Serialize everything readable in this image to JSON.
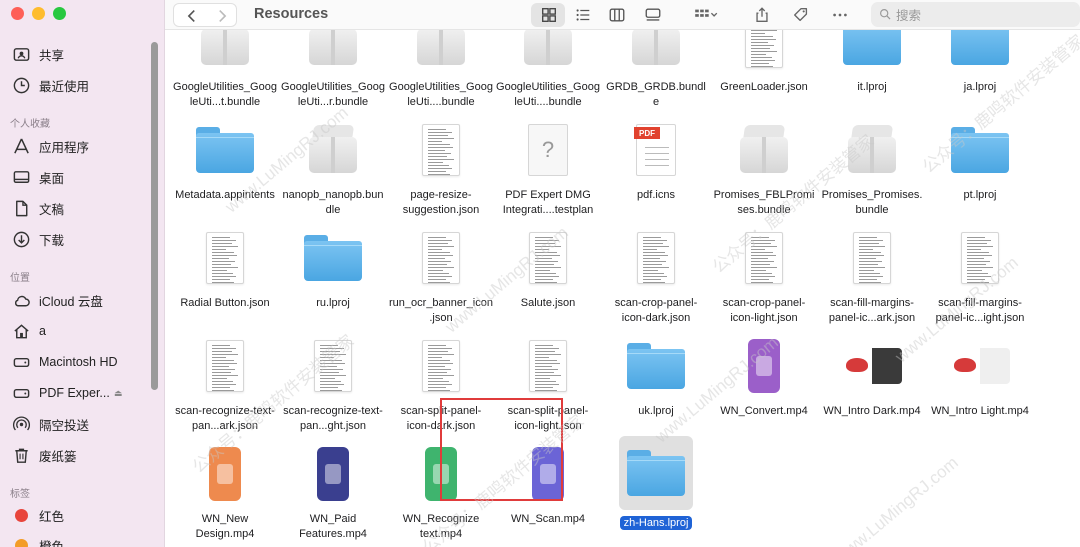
{
  "window": {
    "title": "Resources",
    "search_placeholder": "搜索"
  },
  "sidebar": {
    "top_items": [
      {
        "label": "共享",
        "icon": "shared-icon"
      },
      {
        "label": "最近使用",
        "icon": "clock-icon"
      }
    ],
    "favorites_heading": "个人收藏",
    "favorites": [
      {
        "label": "应用程序",
        "icon": "apps-icon"
      },
      {
        "label": "桌面",
        "icon": "desktop-icon"
      },
      {
        "label": "文稿",
        "icon": "document-icon"
      },
      {
        "label": "下载",
        "icon": "download-icon"
      }
    ],
    "locations_heading": "位置",
    "locations": [
      {
        "label": "iCloud 云盘",
        "icon": "cloud-icon"
      },
      {
        "label": "a",
        "icon": "home-icon"
      },
      {
        "label": "Macintosh HD",
        "icon": "disk-icon"
      },
      {
        "label": "PDF Exper...",
        "icon": "disk-icon",
        "eject": "⏏"
      },
      {
        "label": "隔空投送",
        "icon": "airdrop-icon"
      },
      {
        "label": "废纸篓",
        "icon": "trash-icon"
      }
    ],
    "tags_heading": "标签",
    "tags": [
      {
        "label": "红色",
        "color": "#e8453c"
      },
      {
        "label": "橙色",
        "color": "#f39c27"
      }
    ]
  },
  "files": [
    {
      "name": "GoogleUtilities_GoogleUti...t.bundle",
      "kind": "bundle"
    },
    {
      "name": "GoogleUtilities_GoogleUti...r.bundle",
      "kind": "bundle"
    },
    {
      "name": "GoogleUtilities_GoogleUti....bundle",
      "kind": "bundle"
    },
    {
      "name": "GoogleUtilities_GoogleUti....bundle",
      "kind": "bundle"
    },
    {
      "name": "GRDB_GRDB.bundle",
      "kind": "bundle"
    },
    {
      "name": "GreenLoader.json",
      "kind": "json"
    },
    {
      "name": "it.lproj",
      "kind": "folder"
    },
    {
      "name": "ja.lproj",
      "kind": "folder"
    },
    {
      "name": "Metadata.appintents",
      "kind": "folder"
    },
    {
      "name": "nanopb_nanopb.bundle",
      "kind": "bundle"
    },
    {
      "name": "page-resize-suggestion.json",
      "kind": "json"
    },
    {
      "name": "PDF Expert DMG Integrati....testplan",
      "kind": "unknown"
    },
    {
      "name": "pdf.icns",
      "kind": "pdf"
    },
    {
      "name": "Promises_FBLPromises.bundle",
      "kind": "bundle"
    },
    {
      "name": "Promises_Promises.bundle",
      "kind": "bundle"
    },
    {
      "name": "pt.lproj",
      "kind": "folder"
    },
    {
      "name": "Radial Button.json",
      "kind": "json"
    },
    {
      "name": "ru.lproj",
      "kind": "folder"
    },
    {
      "name": "run_ocr_banner_icon.json",
      "kind": "json"
    },
    {
      "name": "Salute.json",
      "kind": "json"
    },
    {
      "name": "scan-crop-panel-icon-dark.json",
      "kind": "json"
    },
    {
      "name": "scan-crop-panel-icon-light.json",
      "kind": "json"
    },
    {
      "name": "scan-fill-margins-panel-ic...ark.json",
      "kind": "json"
    },
    {
      "name": "scan-fill-margins-panel-ic...ight.json",
      "kind": "json"
    },
    {
      "name": "scan-recognize-text-pan...ark.json",
      "kind": "json"
    },
    {
      "name": "scan-recognize-text-pan...ght.json",
      "kind": "json"
    },
    {
      "name": "scan-split-panel-icon-dark.json",
      "kind": "json"
    },
    {
      "name": "scan-split-panel-icon-light.json",
      "kind": "json"
    },
    {
      "name": "uk.lproj",
      "kind": "folder"
    },
    {
      "name": "WN_Convert.mp4",
      "kind": "mp4",
      "color": "#9b5fc9"
    },
    {
      "name": "WN_Intro Dark.mp4",
      "kind": "intro-dark"
    },
    {
      "name": "WN_Intro Light.mp4",
      "kind": "intro-light"
    },
    {
      "name": "WN_New Design.mp4",
      "kind": "mp4",
      "color": "#ee8a4e"
    },
    {
      "name": "WN_Paid Features.mp4",
      "kind": "mp4",
      "color": "#3a3f8f"
    },
    {
      "name": "WN_Recognize text.mp4",
      "kind": "mp4",
      "color": "#3fb46e"
    },
    {
      "name": "WN_Scan.mp4",
      "kind": "mp4",
      "color": "#6b64d6"
    },
    {
      "name": "zh-Hans.lproj",
      "kind": "folder",
      "selected": true
    }
  ],
  "watermarks": [
    "www.LuMingRJ.com",
    "公众号：鹿鸣软件安装管家"
  ]
}
